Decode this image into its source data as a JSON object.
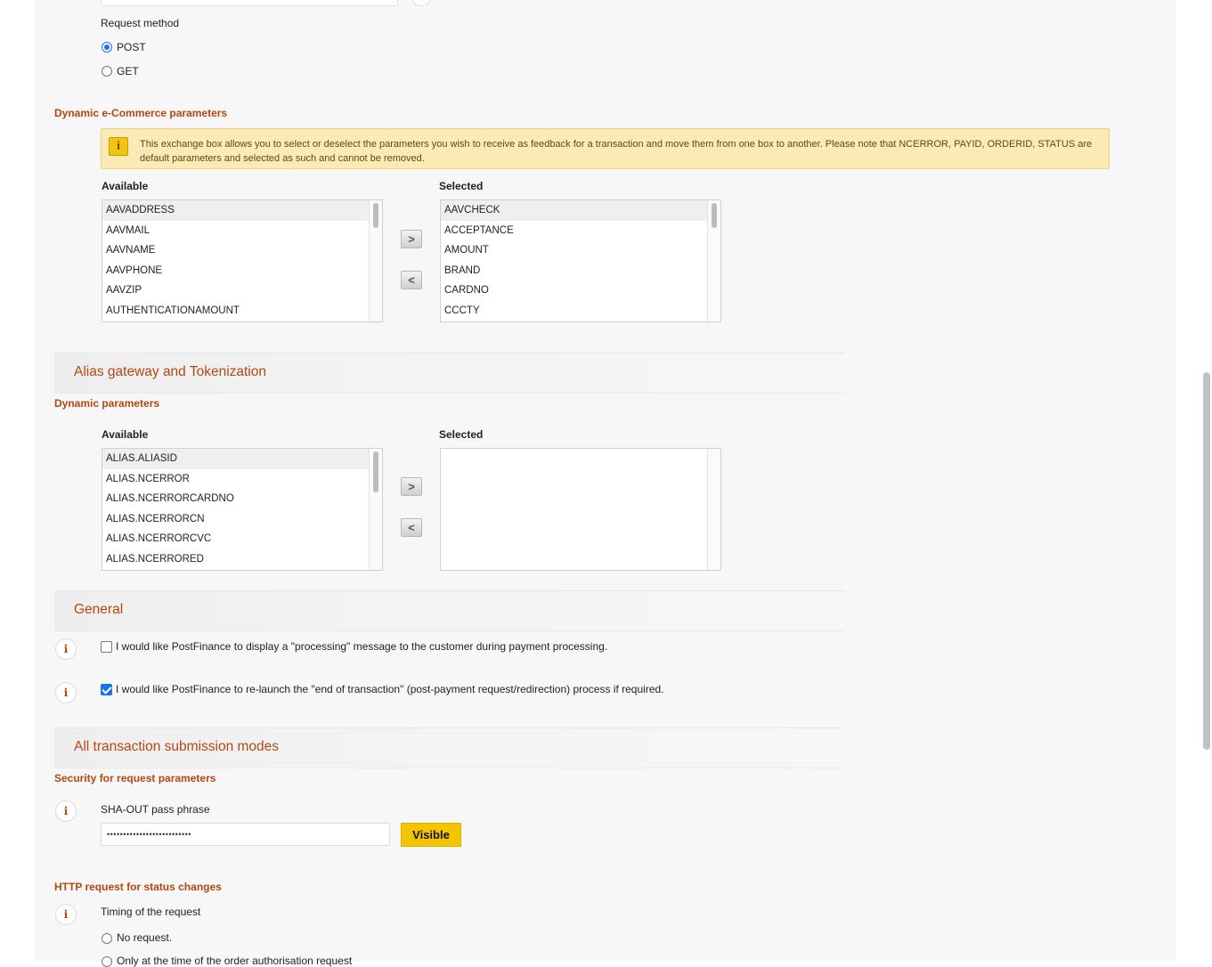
{
  "request_method": {
    "label": "Request method",
    "options": [
      {
        "label": "POST",
        "checked": true
      },
      {
        "label": "GET",
        "checked": false
      }
    ]
  },
  "dynamic_ecommerce": {
    "title": "Dynamic e-Commerce parameters",
    "notice": "This exchange box allows you to select or deselect the parameters you wish to receive as feedback for a transaction and move them from one box to another. Please note that NCERROR, PAYID, ORDERID, STATUS are default parameters and selected as such and cannot be removed.",
    "available_label": "Available",
    "selected_label": "Selected",
    "available": [
      "AAVADDRESS",
      "AAVMAIL",
      "AAVNAME",
      "AAVPHONE",
      "AAVZIP",
      "AUTHENTICATIONAMOUNT"
    ],
    "selected": [
      "AAVCHECK",
      "ACCEPTANCE",
      "AMOUNT",
      "BRAND",
      "CARDNO",
      "CCCTY"
    ]
  },
  "alias": {
    "section_title": "Alias gateway and Tokenization",
    "subtitle": "Dynamic parameters",
    "available_label": "Available",
    "selected_label": "Selected",
    "available": [
      "ALIAS.ALIASID",
      "ALIAS.NCERROR",
      "ALIAS.NCERRORCARDNO",
      "ALIAS.NCERRORCN",
      "ALIAS.NCERRORCVC",
      "ALIAS.NCERRORED"
    ],
    "selected": []
  },
  "general": {
    "section_title": "General",
    "options": [
      {
        "label": "I would like PostFinance to display a \"processing\" message to the customer during payment processing.",
        "checked": false
      },
      {
        "label": "I would like PostFinance to re-launch the \"end of transaction\" (post-payment request/redirection) process if required.",
        "checked": true
      }
    ]
  },
  "transaction_modes": {
    "section_title": "All transaction submission modes",
    "security_title": "Security for request parameters",
    "sha_label": "SHA-OUT pass phrase",
    "sha_value": "••••••••••••••••••••••••••",
    "visible_button": "Visible"
  },
  "http_request": {
    "title": "HTTP request for status changes",
    "timing_label": "Timing of the request",
    "options": [
      {
        "label": "No request.",
        "checked": false
      },
      {
        "label": "Only at the time of the order authorisation request",
        "checked": false
      }
    ]
  },
  "icons": {
    "notice": "info-notice-icon",
    "info": "info-icon",
    "move_right": "chevron-right-icon",
    "move_left": "chevron-left-icon"
  },
  "colors": {
    "accent": "#b4470f",
    "notice_bg": "#fbeab6",
    "button_yellow": "#f5c400",
    "checkbox_blue": "#1a73e8"
  }
}
